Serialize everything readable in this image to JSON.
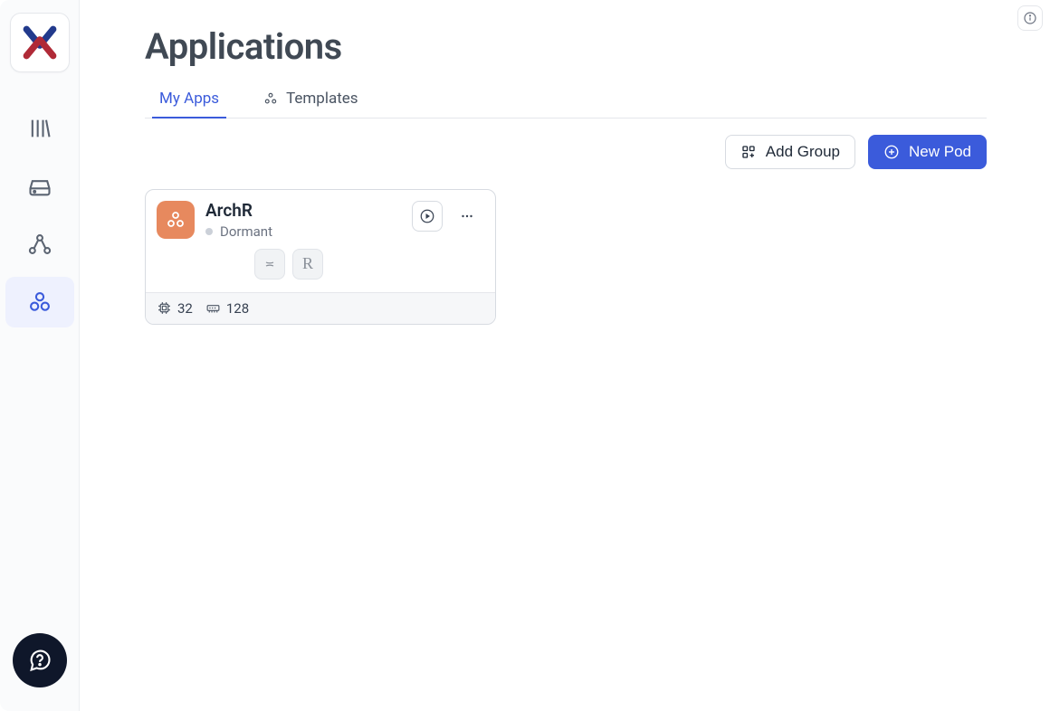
{
  "page": {
    "title": "Applications"
  },
  "tabs": {
    "myApps": "My Apps",
    "templates": "Templates"
  },
  "actions": {
    "addGroup": "Add Group",
    "newPod": "New Pod"
  },
  "app": {
    "name": "ArchR",
    "status": "Dormant",
    "cpu": "32",
    "mem": "128",
    "miniR": "R"
  }
}
